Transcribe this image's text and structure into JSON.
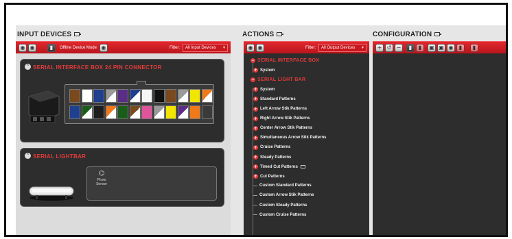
{
  "input_devices": {
    "title": "INPUT DEVICES",
    "toolbar": {
      "offline_label": "Offline Device Mode",
      "filter_label": "Filter:",
      "filter_value": "All Input Devices"
    },
    "panels": [
      {
        "title": "SERIAL INTERFACE BOX 24 PIN CONNECTOR",
        "wire_colors": [
          [
            "#7a4a1e",
            "#ffffff",
            "#1f3f8f",
            "#9a9a9a",
            "#5a2d86",
            "#1f3f8f",
            "#f5f5f5",
            "#111111",
            "#7a4a1e",
            "#9a9a9a",
            "#f2e600",
            "#f07a1a"
          ],
          [
            "#1f3f8f",
            "#1a5c1a",
            "#1e1e1e",
            "#f07a1a",
            "#1a5c1a",
            "#7a4a1e",
            "#e0559a",
            "#9a9a9a",
            "#f2e600",
            "#5a2d86",
            "#f07a1a",
            "#3a3a3a"
          ]
        ]
      },
      {
        "title": "SERIAL LIGHTBAR",
        "sensor_label_1": "Photo",
        "sensor_label_2": "Sensor"
      }
    ]
  },
  "actions": {
    "title": "ACTIONS",
    "toolbar": {
      "filter_label": "Filter:",
      "filter_value": "All Output Devices"
    },
    "tree": [
      {
        "label": "SERIAL INTERFACE BOX",
        "type": "root"
      },
      {
        "label": "System",
        "type": "child"
      },
      {
        "label": "SERIAL LIGHT BAR",
        "type": "root"
      },
      {
        "label": "System",
        "type": "child"
      },
      {
        "label": "Standard Patterns",
        "type": "child"
      },
      {
        "label": "Left Arrow Stik Patterns",
        "type": "child"
      },
      {
        "label": "Right Arrow Stik Patterns",
        "type": "child"
      },
      {
        "label": "Center Arrow Stik Patterns",
        "type": "child"
      },
      {
        "label": "Simultaneous Arrow Stik Patterns",
        "type": "child"
      },
      {
        "label": "Cruise Patterns",
        "type": "child"
      },
      {
        "label": "Steady Patterns",
        "type": "child"
      },
      {
        "label": "Timed Cut Patterns",
        "type": "child"
      },
      {
        "label": "Cut Patterns",
        "type": "child"
      },
      {
        "label": "Custom Standard Patterns",
        "type": "leaf"
      },
      {
        "label": "Custom Arrow Stik Patterns",
        "type": "leaf"
      },
      {
        "label": "Custom Steady Patterns",
        "type": "leaf"
      },
      {
        "label": "Custom Cruise Patterns",
        "type": "leaf"
      }
    ]
  },
  "configuration": {
    "title": "CONFIGURATION"
  },
  "colors": {
    "accent_red": "#d01e24",
    "panel_dark": "#2d2d2d",
    "tree_root_red": "#e53a3a"
  }
}
